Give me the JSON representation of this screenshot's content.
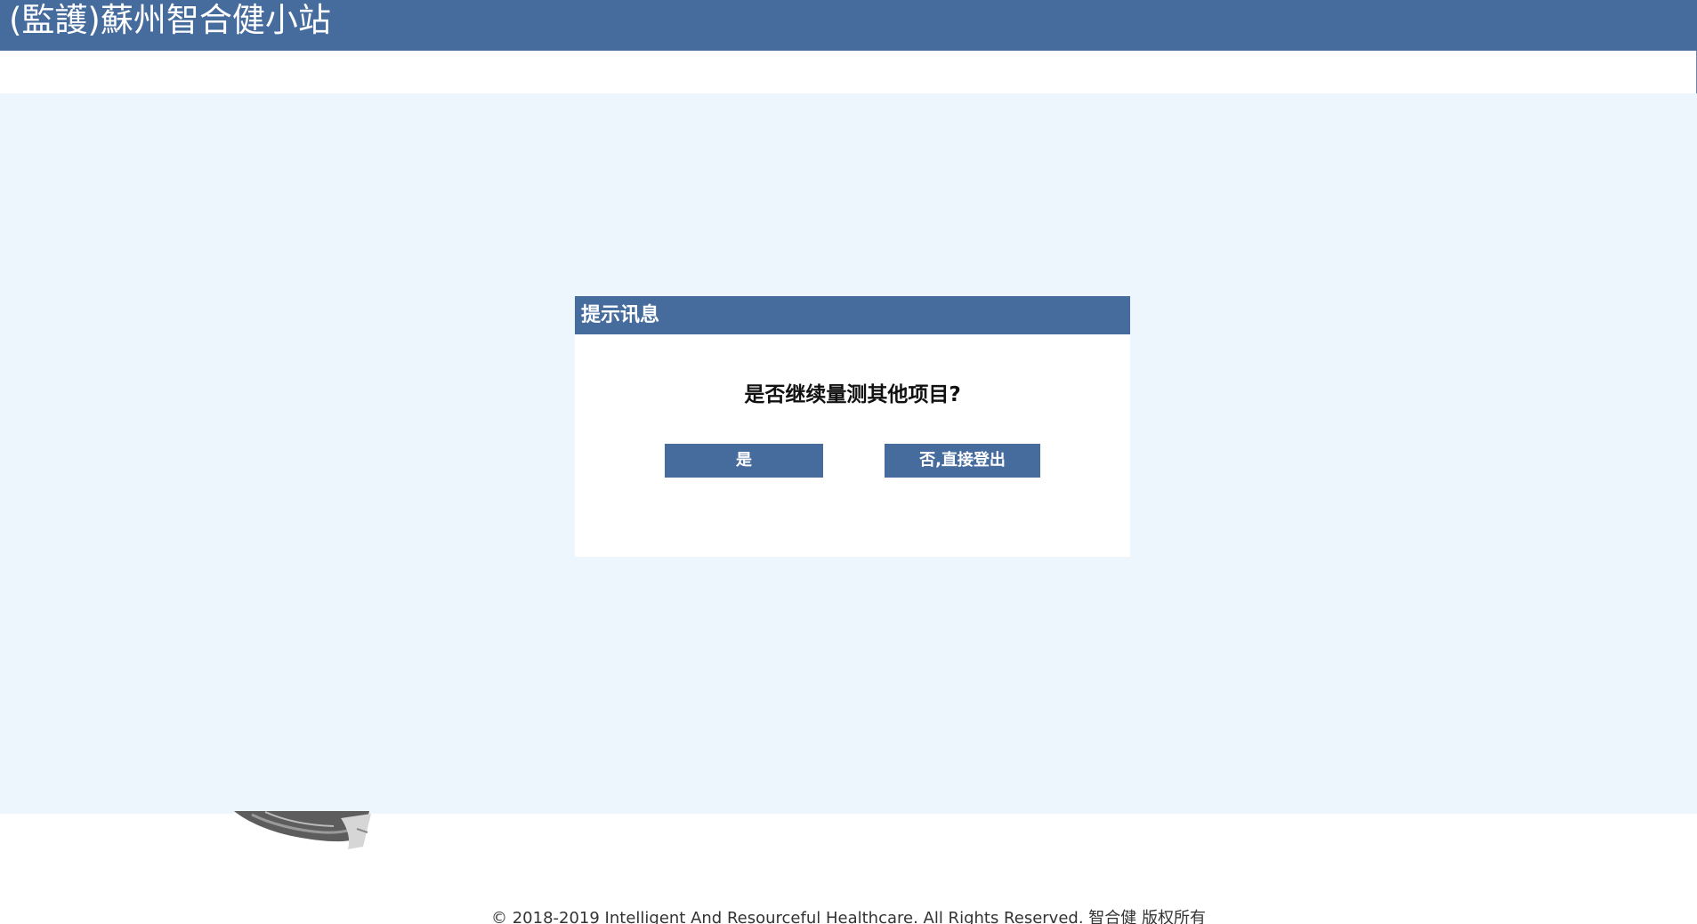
{
  "header": {
    "title": "(監護)蘇州智合健小站"
  },
  "dialog": {
    "title": "提示讯息",
    "message": "是否继续量测其他项目?",
    "yes_label": "是",
    "no_label": "否,直接登出"
  },
  "footer": {
    "text": "© 2018-2019 Intelligent And Resourceful Healthcare. All Rights Reserved. 智合健 版权所有"
  },
  "colors": {
    "primary": "#466b9d",
    "overlay": "#eef6fd",
    "background": "#ffffff"
  },
  "icons": {
    "decoration": "grayscale-hand-image"
  }
}
